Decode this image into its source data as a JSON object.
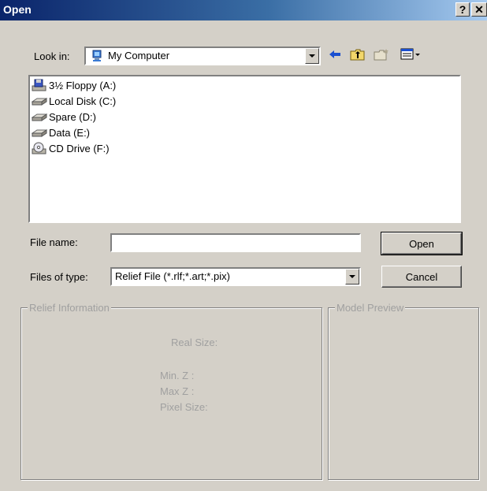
{
  "window": {
    "title": "Open",
    "help_button": "?",
    "close_button": "✕"
  },
  "look_in": {
    "label": "Look in:",
    "value": "My Computer",
    "icon": "computer-icon"
  },
  "toolbar": {
    "back_icon": "back-arrow-icon",
    "up_icon": "up-folder-icon",
    "new_folder_icon": "new-folder-icon",
    "view_menu_icon": "view-menu-icon"
  },
  "file_list": [
    {
      "label": "3½ Floppy (A:)",
      "icon": "floppy-drive-icon"
    },
    {
      "label": "Local Disk (C:)",
      "icon": "hard-disk-icon"
    },
    {
      "label": "Spare (D:)",
      "icon": "hard-disk-icon"
    },
    {
      "label": "Data (E:)",
      "icon": "hard-disk-icon"
    },
    {
      "label": "CD Drive (F:)",
      "icon": "cd-drive-icon"
    }
  ],
  "file_name": {
    "label": "File name:",
    "value": ""
  },
  "file_type": {
    "label": "Files of type:",
    "value": "Relief File (*.rlf;*.art;*.pix)"
  },
  "buttons": {
    "open": "Open",
    "cancel": "Cancel"
  },
  "relief_info": {
    "title": "Relief Information",
    "real_size": "Real Size:",
    "min_z": "Min. Z :",
    "max_z": "Max Z :",
    "pixel_size": "Pixel Size:"
  },
  "model_preview": {
    "title": "Model Preview"
  }
}
